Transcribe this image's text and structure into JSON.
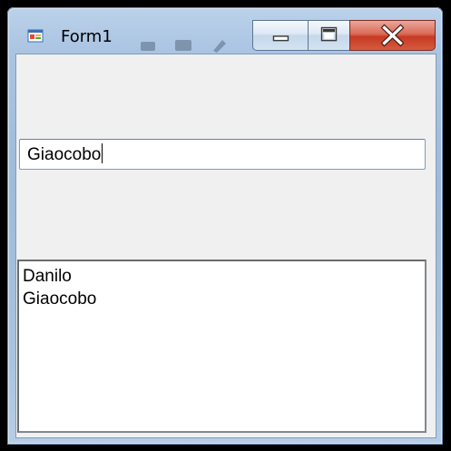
{
  "window": {
    "title": "Form1",
    "icon": "winforms-form-icon"
  },
  "caption_buttons": {
    "minimize_icon": "minimize-icon",
    "maximize_icon": "maximize-icon",
    "close_icon": "close-icon"
  },
  "textbox": {
    "value": "Giaocobo"
  },
  "listbox": {
    "items": [
      "Danilo",
      "Giaocobo"
    ]
  },
  "colors": {
    "frame_glass": "#a9c3df",
    "client_background": "#f0f0f0",
    "close_button": "#c63a23",
    "textbox_border": "#7a9cc4",
    "listbox_border": "#828790"
  }
}
